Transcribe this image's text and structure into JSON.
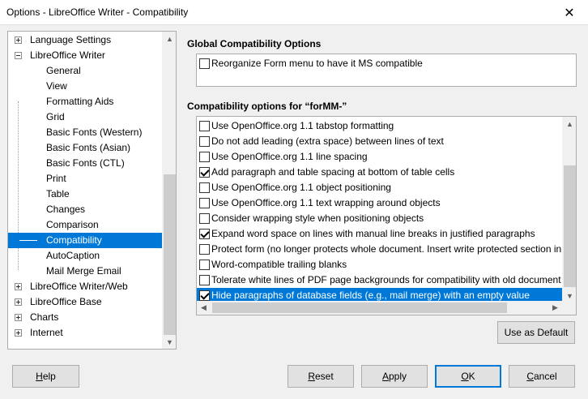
{
  "window": {
    "title": "Options - LibreOffice Writer - Compatibility",
    "close_glyph": "✕"
  },
  "tree": {
    "items": [
      {
        "label": "Language Settings",
        "level": 0,
        "expander": "plus",
        "selected": false
      },
      {
        "label": "LibreOffice Writer",
        "level": 0,
        "expander": "minus",
        "selected": false
      },
      {
        "label": "General",
        "level": 1,
        "selected": false
      },
      {
        "label": "View",
        "level": 1,
        "selected": false
      },
      {
        "label": "Formatting Aids",
        "level": 1,
        "selected": false
      },
      {
        "label": "Grid",
        "level": 1,
        "selected": false
      },
      {
        "label": "Basic Fonts (Western)",
        "level": 1,
        "selected": false
      },
      {
        "label": "Basic Fonts (Asian)",
        "level": 1,
        "selected": false
      },
      {
        "label": "Basic Fonts (CTL)",
        "level": 1,
        "selected": false
      },
      {
        "label": "Print",
        "level": 1,
        "selected": false
      },
      {
        "label": "Table",
        "level": 1,
        "selected": false
      },
      {
        "label": "Changes",
        "level": 1,
        "selected": false
      },
      {
        "label": "Comparison",
        "level": 1,
        "selected": false
      },
      {
        "label": "Compatibility",
        "level": 1,
        "selected": true
      },
      {
        "label": "AutoCaption",
        "level": 1,
        "selected": false
      },
      {
        "label": "Mail Merge Email",
        "level": 1,
        "selected": false
      },
      {
        "label": "LibreOffice Writer/Web",
        "level": 0,
        "expander": "plus",
        "selected": false
      },
      {
        "label": "LibreOffice Base",
        "level": 0,
        "expander": "plus",
        "selected": false
      },
      {
        "label": "Charts",
        "level": 0,
        "expander": "plus",
        "selected": false
      },
      {
        "label": "Internet",
        "level": 0,
        "expander": "plus",
        "selected": false
      }
    ]
  },
  "global": {
    "title": "Global Compatibility Options",
    "options": [
      {
        "label": "Reorganize Form menu to have it MS compatible",
        "checked": false
      }
    ]
  },
  "compat": {
    "title": "Compatibility options for “forMM-”",
    "options": [
      {
        "label": "Use OpenOffice.org 1.1 tabstop formatting",
        "checked": false,
        "selected": false
      },
      {
        "label": "Do not add leading (extra space) between lines of text",
        "checked": false,
        "selected": false
      },
      {
        "label": "Use OpenOffice.org 1.1 line spacing",
        "checked": false,
        "selected": false
      },
      {
        "label": "Add paragraph and table spacing at bottom of table cells",
        "checked": true,
        "selected": false
      },
      {
        "label": "Use OpenOffice.org 1.1 object positioning",
        "checked": false,
        "selected": false
      },
      {
        "label": "Use OpenOffice.org 1.1 text wrapping around objects",
        "checked": false,
        "selected": false
      },
      {
        "label": "Consider wrapping style when positioning objects",
        "checked": false,
        "selected": false
      },
      {
        "label": "Expand word space on lines with manual line breaks in justified paragraphs",
        "checked": true,
        "selected": false
      },
      {
        "label": "Protect form (no longer protects whole document. Insert write protected section in",
        "checked": false,
        "selected": false
      },
      {
        "label": "Word-compatible trailing blanks",
        "checked": false,
        "selected": false
      },
      {
        "label": "Tolerate white lines of PDF page backgrounds for compatibility with old document",
        "checked": false,
        "selected": false
      },
      {
        "label": "Hide paragraphs of database fields (e.g., mail merge) with an empty value",
        "checked": true,
        "selected": true
      }
    ],
    "use_as_default_label": "Use as Default"
  },
  "buttons": {
    "help": {
      "accel": "H",
      "rest": "elp"
    },
    "reset": {
      "accel": "R",
      "rest": "eset"
    },
    "apply": {
      "accel": "A",
      "rest": "pply"
    },
    "ok": {
      "accel": "O",
      "rest": "K"
    },
    "cancel": {
      "accel": "C",
      "rest": "ancel"
    }
  },
  "scroll_glyphs": {
    "up": "▲",
    "down": "▼",
    "left": "◀",
    "right": "▶"
  },
  "colors": {
    "selection": "#0078d7"
  }
}
